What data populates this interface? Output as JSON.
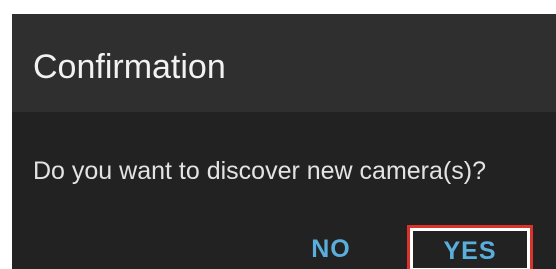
{
  "dialog": {
    "title": "Confirmation",
    "message": "Do you want to discover new camera(s)?",
    "buttons": {
      "no_label": "NO",
      "yes_label": "YES"
    }
  },
  "colors": {
    "header_background": "#2f2f2f",
    "body_background": "#222222",
    "title_text": "#f2f2f2",
    "message_text": "#e3e3e3",
    "button_text": "#5aaedc",
    "highlight_border": "#d9342b"
  }
}
